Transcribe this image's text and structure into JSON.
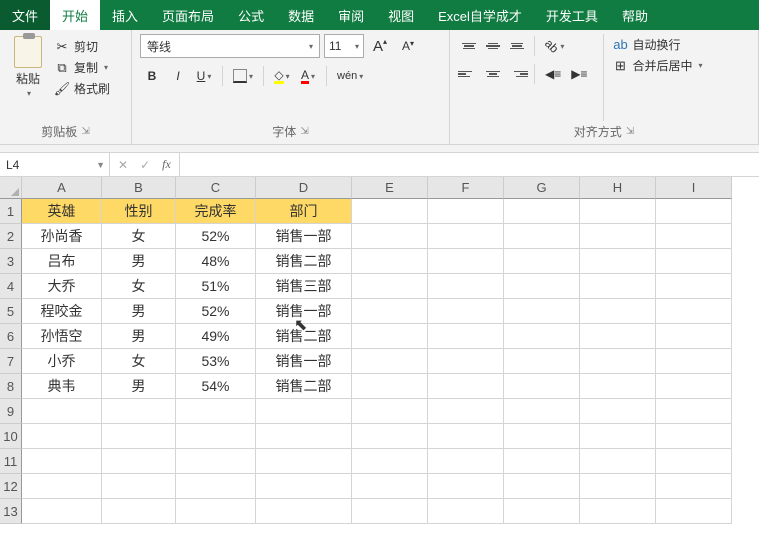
{
  "menu": [
    "文件",
    "开始",
    "插入",
    "页面布局",
    "公式",
    "数据",
    "审阅",
    "视图",
    "Excel自学成才",
    "开发工具",
    "帮助"
  ],
  "menu_active_index": 1,
  "ribbon": {
    "clipboard": {
      "paste": "粘贴",
      "cut": "剪切",
      "copy": "复制",
      "format_painter": "格式刷",
      "label": "剪贴板"
    },
    "font": {
      "name": "等线",
      "size": "11",
      "bold": "B",
      "italic": "I",
      "underline": "U",
      "wen": "wén",
      "label": "字体",
      "increase": "A",
      "decrease": "A"
    },
    "align": {
      "wrap": "自动换行",
      "merge": "合并后居中",
      "label": "对齐方式"
    }
  },
  "name_box": "L4",
  "columns": [
    "A",
    "B",
    "C",
    "D",
    "E",
    "F",
    "G",
    "H",
    "I"
  ],
  "col_widths": [
    "w-a",
    "w-b",
    "w-c",
    "w-d",
    "w-e",
    "w-f",
    "w-g",
    "w-h",
    "w-i"
  ],
  "header_row": [
    "英雄",
    "性别",
    "完成率",
    "部门"
  ],
  "data_rows": [
    [
      "孙尚香",
      "女",
      "52%",
      "销售一部"
    ],
    [
      "吕布",
      "男",
      "48%",
      "销售二部"
    ],
    [
      "大乔",
      "女",
      "51%",
      "销售三部"
    ],
    [
      "程咬金",
      "男",
      "52%",
      "销售一部"
    ],
    [
      "孙悟空",
      "男",
      "49%",
      "销售二部"
    ],
    [
      "小乔",
      "女",
      "53%",
      "销售一部"
    ],
    [
      "典韦",
      "男",
      "54%",
      "销售二部"
    ]
  ],
  "total_rows": 13,
  "chart_data": {
    "type": "table",
    "columns": [
      "英雄",
      "性别",
      "完成率",
      "部门"
    ],
    "rows": [
      {
        "英雄": "孙尚香",
        "性别": "女",
        "完成率": 0.52,
        "部门": "销售一部"
      },
      {
        "英雄": "吕布",
        "性别": "男",
        "完成率": 0.48,
        "部门": "销售二部"
      },
      {
        "英雄": "大乔",
        "性别": "女",
        "完成率": 0.51,
        "部门": "销售三部"
      },
      {
        "英雄": "程咬金",
        "性别": "男",
        "完成率": 0.52,
        "部门": "销售一部"
      },
      {
        "英雄": "孙悟空",
        "性别": "男",
        "完成率": 0.49,
        "部门": "销售二部"
      },
      {
        "英雄": "小乔",
        "性别": "女",
        "完成率": 0.53,
        "部门": "销售一部"
      },
      {
        "英雄": "典韦",
        "性别": "男",
        "完成率": 0.54,
        "部门": "销售二部"
      }
    ]
  }
}
